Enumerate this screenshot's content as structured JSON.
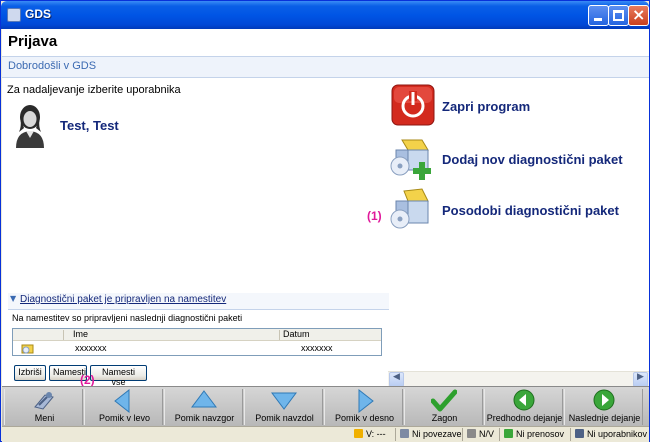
{
  "window": {
    "title": "GDS"
  },
  "page": {
    "title": "Prijava",
    "subtitle": "Dobrodošli v GDS",
    "prompt": "Za nadaljevanje izberite uporabnika"
  },
  "user": {
    "name": "Test, Test"
  },
  "actions": [
    {
      "label": "Zapri program",
      "icon": "power-icon"
    },
    {
      "label": "Dodaj nov diagnostični paket",
      "icon": "package-add-icon"
    },
    {
      "label": "Posodobi diagnostični paket",
      "icon": "package-update-icon",
      "marker": "(1)"
    }
  ],
  "package_panel": {
    "header": "Diagnostični paket je pripravljen na namestitev",
    "description": "Na namestitev so pripravljeni naslednji diagnostični paketi",
    "columns": [
      "Ime",
      "Datum"
    ],
    "rows": [
      {
        "name": "xxxxxxx",
        "date": "xxxxxxx"
      }
    ],
    "buttons": {
      "delete": "Izbriši",
      "install": "Namesti",
      "install_all": "Namesti vse"
    },
    "marker": "(2)"
  },
  "toolbar": [
    {
      "label": "Meni",
      "icon": "menu-icon"
    },
    {
      "label": "Pomik v levo",
      "icon": "arrow-left-icon"
    },
    {
      "label": "Pomik navzgor",
      "icon": "arrow-up-icon"
    },
    {
      "label": "Pomik navzdol",
      "icon": "arrow-down-icon"
    },
    {
      "label": "Pomik v desno",
      "icon": "arrow-right-icon"
    },
    {
      "label": "Zagon",
      "icon": "checkmark-icon"
    },
    {
      "label": "Predhodno dejanje",
      "icon": "back-icon"
    },
    {
      "label": "Naslednje dejanje",
      "icon": "forward-icon"
    }
  ],
  "status": {
    "voltage": "V: ---",
    "connection": "Ni povezave",
    "nv": "N/V",
    "transfer": "Ni prenosov",
    "user": "Ni uporabnikov"
  },
  "colors": {
    "link": "#14287a",
    "marker": "#e0199b",
    "titlebar": "#0055e5"
  }
}
